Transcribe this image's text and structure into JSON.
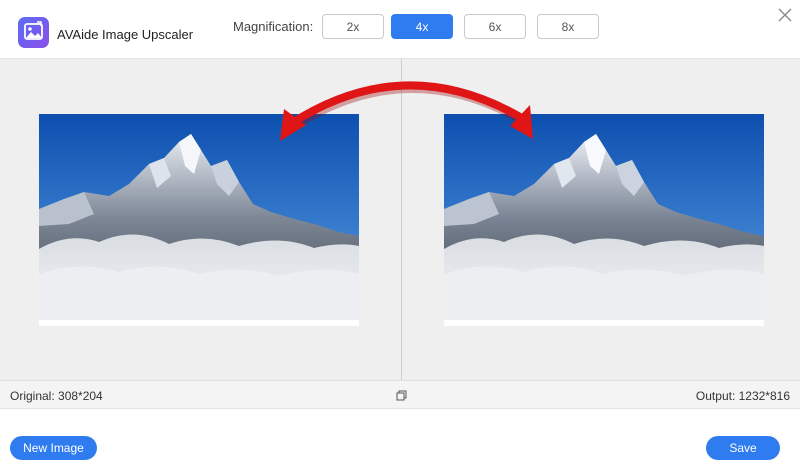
{
  "header": {
    "app_title": "AVAide Image Upscaler",
    "magnification_label": "Magnification:",
    "magnification_options": [
      "2x",
      "4x",
      "6x",
      "8x"
    ],
    "selected_magnification": "4x",
    "logo_icon": "image-upscale-logo-icon",
    "close_icon": "close-icon"
  },
  "preview": {
    "original_image": "mountain-photo",
    "upscaled_image": "mountain-photo"
  },
  "status": {
    "original_label": "Original: 308*204",
    "output_label": "Output: 1232*816",
    "compare_icon": "compare-toggle-icon"
  },
  "footer": {
    "new_image_label": "New Image",
    "save_label": "Save"
  },
  "colors": {
    "accent": "#2f7cf0",
    "arrow": "#e01515",
    "preview_bg": "#efefef"
  }
}
